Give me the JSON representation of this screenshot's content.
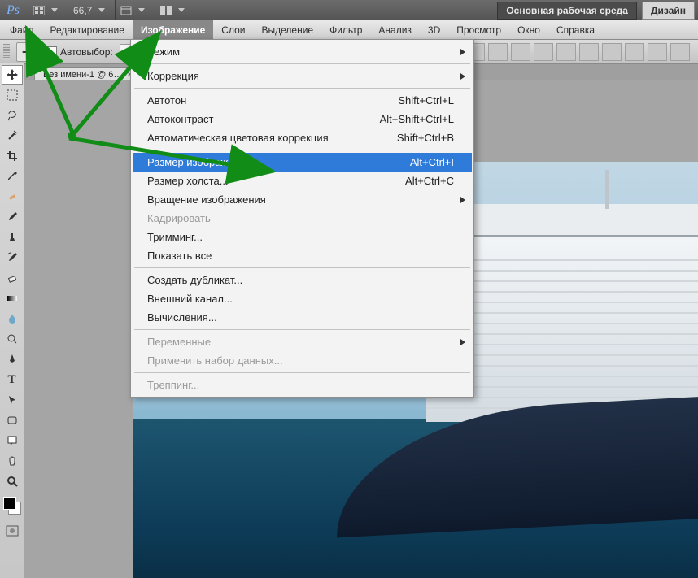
{
  "appbar": {
    "zoom_label": "66,7",
    "workspace_primary": "Основная рабочая среда",
    "workspace_secondary": "Дизайн"
  },
  "menubar": {
    "items": [
      {
        "label": "Файл"
      },
      {
        "label": "Редактирование"
      },
      {
        "label": "Изображение"
      },
      {
        "label": "Слои"
      },
      {
        "label": "Выделение"
      },
      {
        "label": "Фильтр"
      },
      {
        "label": "Анализ"
      },
      {
        "label": "3D"
      },
      {
        "label": "Просмотр"
      },
      {
        "label": "Окно"
      },
      {
        "label": "Справка"
      }
    ],
    "open_index": 2
  },
  "optbar": {
    "autoselect_label": "Автовыбор:"
  },
  "document_tab": {
    "title": "Без имени-1 @ 6…"
  },
  "dropdown": {
    "groups": [
      [
        {
          "label": "Режим",
          "submenu": true
        }
      ],
      [
        {
          "label": "Коррекция",
          "submenu": true
        }
      ],
      [
        {
          "label": "Автотон",
          "shortcut": "Shift+Ctrl+L"
        },
        {
          "label": "Автоконтраст",
          "shortcut": "Alt+Shift+Ctrl+L"
        },
        {
          "label": "Автоматическая цветовая коррекция",
          "shortcut": "Shift+Ctrl+B"
        }
      ],
      [
        {
          "label": "Размер изображения...",
          "shortcut": "Alt+Ctrl+I",
          "highlight": true
        },
        {
          "label": "Размер холста...",
          "shortcut": "Alt+Ctrl+C"
        },
        {
          "label": "Вращение изображения",
          "submenu": true
        },
        {
          "label": "Кадрировать",
          "disabled": true
        },
        {
          "label": "Тримминг..."
        },
        {
          "label": "Показать все"
        }
      ],
      [
        {
          "label": "Создать дубликат..."
        },
        {
          "label": "Внешний канал..."
        },
        {
          "label": "Вычисления..."
        }
      ],
      [
        {
          "label": "Переменные",
          "submenu": true,
          "disabled": true
        },
        {
          "label": "Применить набор данных...",
          "disabled": true
        }
      ],
      [
        {
          "label": "Треппинг...",
          "disabled": true
        }
      ]
    ]
  },
  "tools": {
    "items": [
      "move",
      "marquee",
      "lasso",
      "wand",
      "crop",
      "eyedropper",
      "healing",
      "brush",
      "stamp",
      "history-brush",
      "eraser",
      "gradient",
      "blur",
      "dodge",
      "pen",
      "type",
      "path-select",
      "rectangle",
      "notes",
      "hand",
      "zoom"
    ]
  },
  "colors": {
    "hl": "#2f7bd9",
    "arrow": "#118c17"
  }
}
